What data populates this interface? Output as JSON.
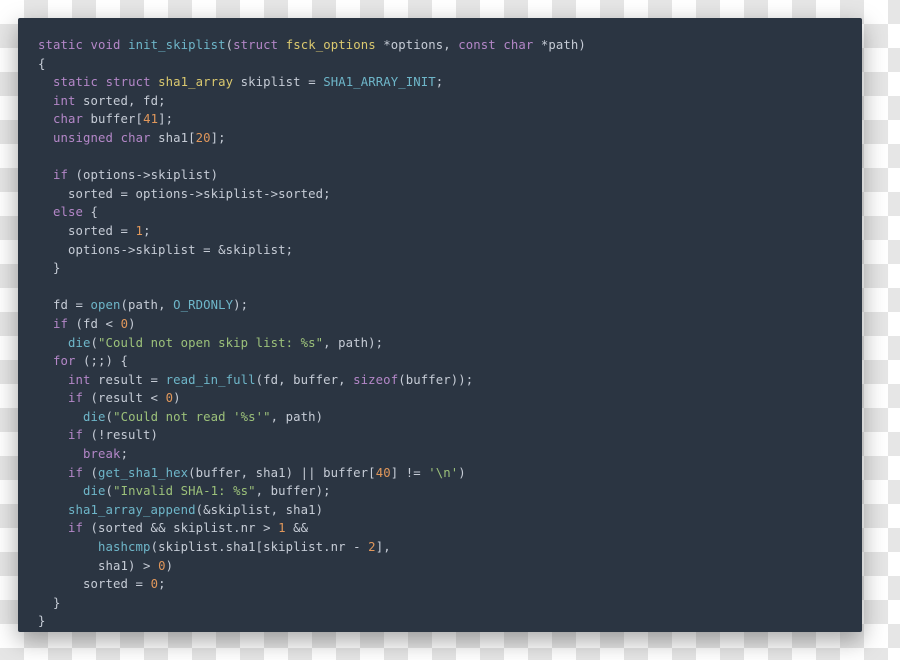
{
  "theme": {
    "bg": "#2b3542",
    "fg": "#c6ccd6",
    "keyword": "#b487c8",
    "type": "#dbc96f",
    "func": "#6eb6c9",
    "string": "#9cc17a",
    "number": "#e0975b",
    "operator": "#8fa0b3"
  },
  "code_language": "c",
  "code_lines": [
    "static void init_skiplist(struct fsck_options *options, const char *path)",
    "{",
    "  static struct sha1_array skiplist = SHA1_ARRAY_INIT;",
    "  int sorted, fd;",
    "  char buffer[41];",
    "  unsigned char sha1[20];",
    "",
    "  if (options->skiplist)",
    "    sorted = options->skiplist->sorted;",
    "  else {",
    "    sorted = 1;",
    "    options->skiplist = &skiplist;",
    "  }",
    "",
    "  fd = open(path, O_RDONLY);",
    "  if (fd < 0)",
    "    die(\"Could not open skip list: %s\", path);",
    "  for (;;) {",
    "    int result = read_in_full(fd, buffer, sizeof(buffer));",
    "    if (result < 0)",
    "      die(\"Could not read '%s'\", path)",
    "    if (!result)",
    "      break;",
    "    if (get_sha1_hex(buffer, sha1) || buffer[40] != '\\n')",
    "      die(\"Invalid SHA-1: %s\", buffer);",
    "    sha1_array_append(&skiplist, sha1)",
    "    if (sorted && skiplist.nr > 1 &&",
    "        hashcmp(skiplist.sha1[skiplist.nr - 2],",
    "        sha1) > 0)",
    "      sorted = 0;",
    "  }",
    "}"
  ],
  "tokens": {
    "keywords": [
      "static",
      "void",
      "struct",
      "const",
      "char",
      "int",
      "unsigned",
      "if",
      "else",
      "for",
      "sizeof",
      "break"
    ],
    "types": [
      "fsck_options",
      "sha1_array"
    ],
    "functions_constants": [
      "init_skiplist",
      "SHA1_ARRAY_INIT",
      "open",
      "O_RDONLY",
      "die",
      "read_in_full",
      "get_sha1_hex",
      "sha1_array_append",
      "hashcmp"
    ],
    "strings": [
      "\"Could not open skip list: %s\"",
      "\"Could not read '%s'\"",
      "\"Invalid SHA-1: %s\"",
      "'\\n'"
    ],
    "numbers": [
      "41",
      "20",
      "1",
      "0",
      "40",
      "2"
    ]
  }
}
